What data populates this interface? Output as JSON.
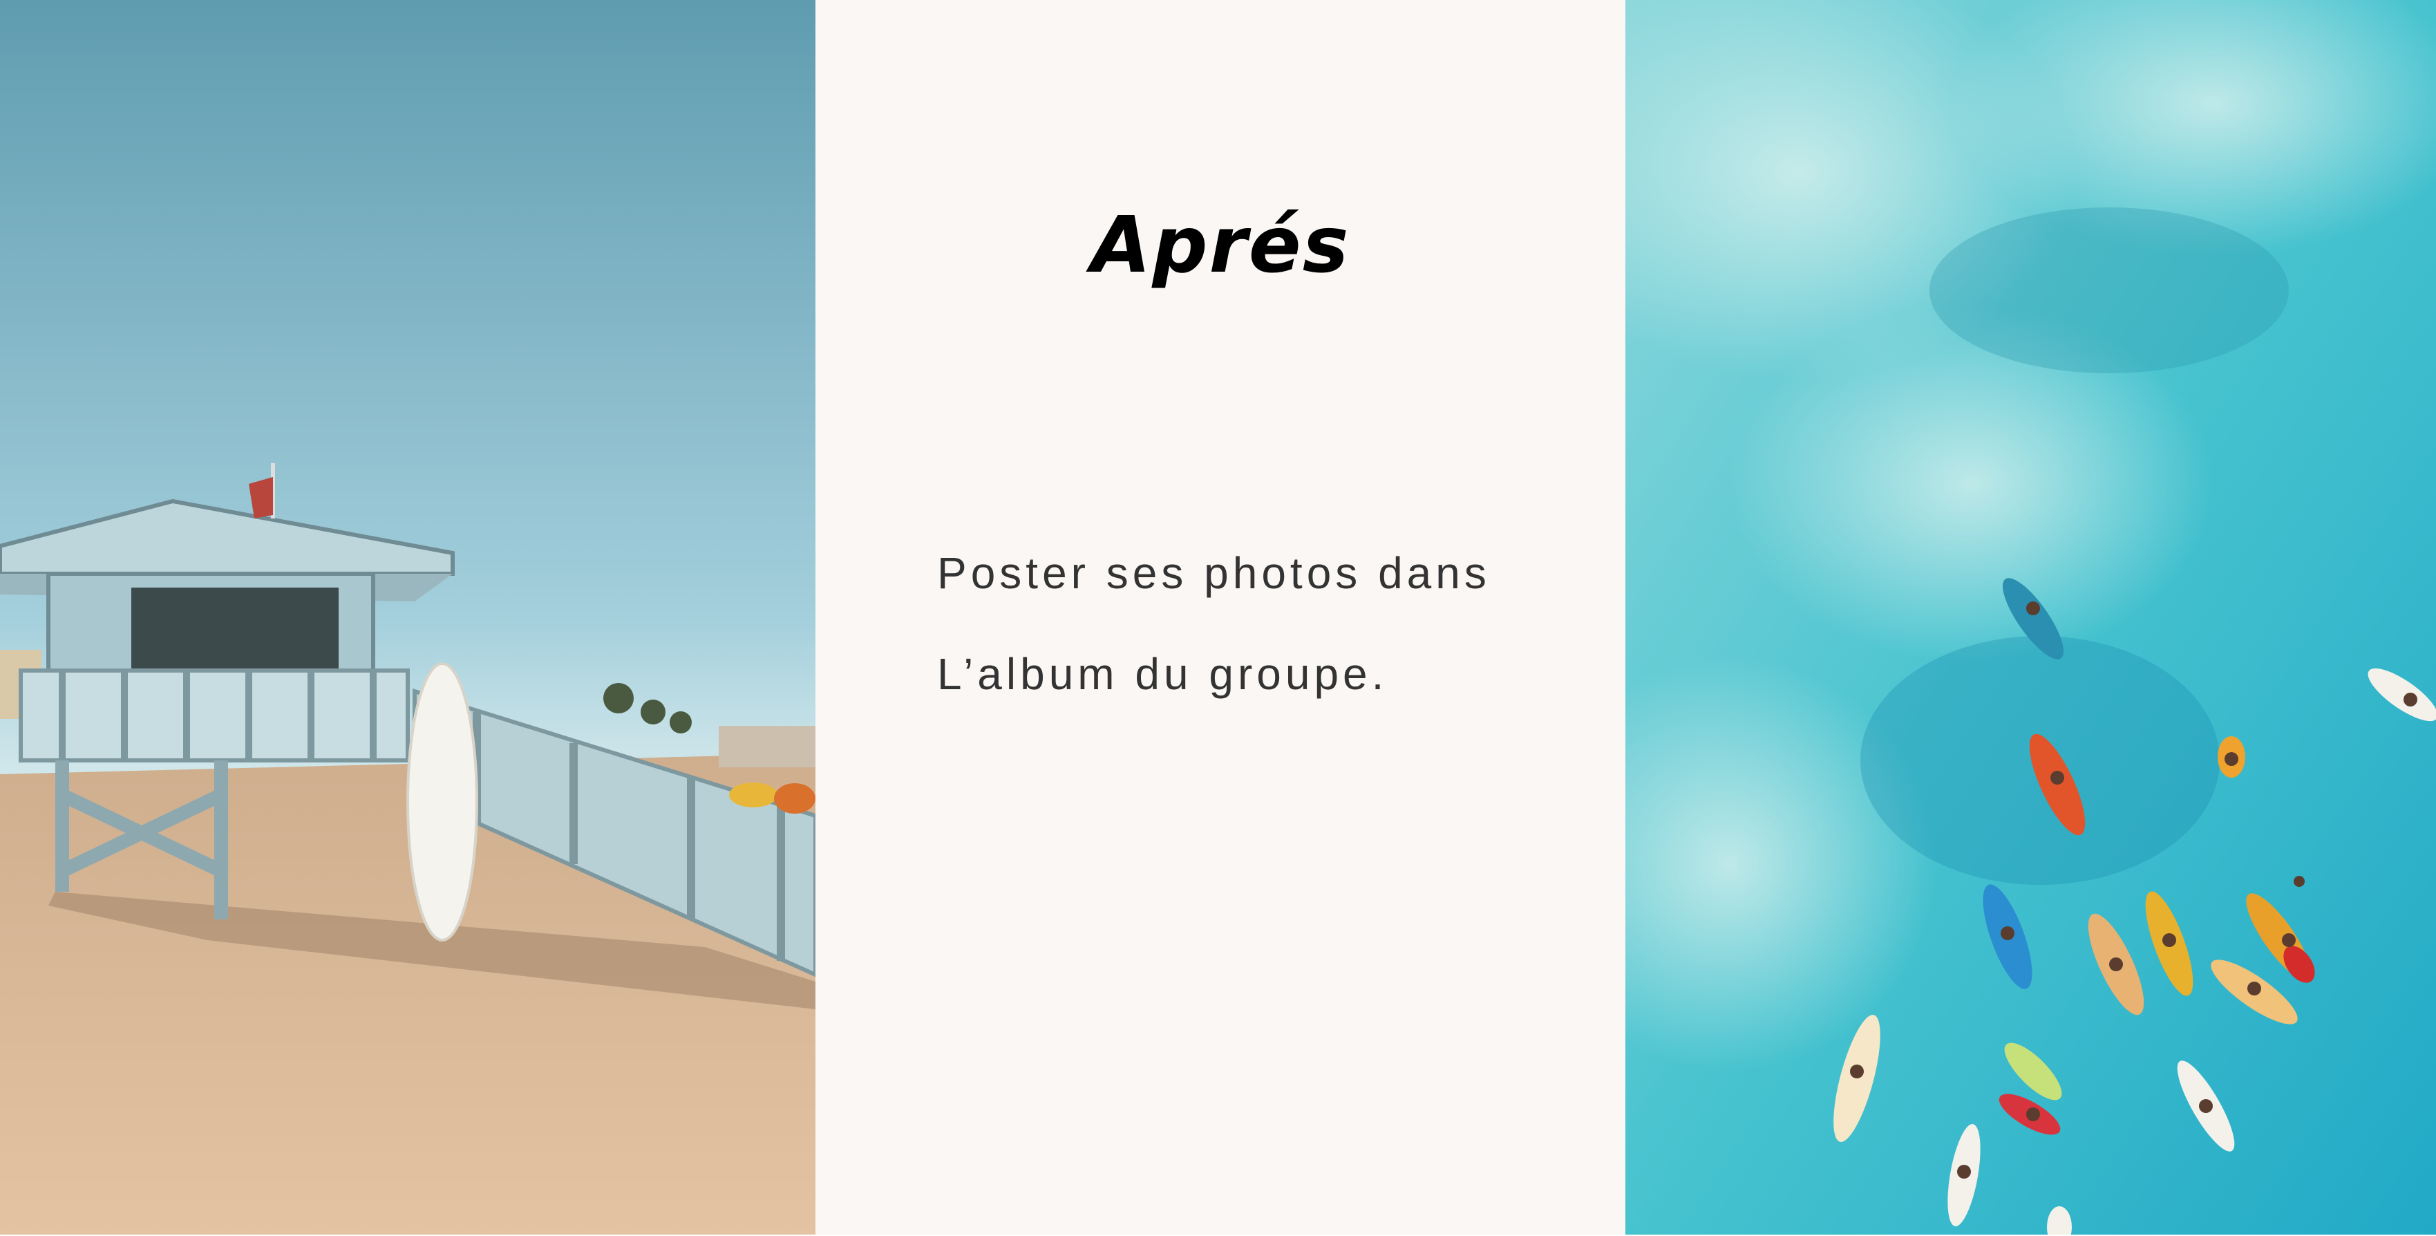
{
  "slide": {
    "title": "Aprés",
    "body_lines": [
      "Poster ses photos dans",
      "L’album du groupe."
    ]
  },
  "colors": {
    "panel_background": "#faf7f4",
    "title_color": "#000000",
    "body_color": "#333333",
    "sky": "#7fb6c8",
    "sand": "#d8b48f",
    "water": "#3fc3cf"
  },
  "images": {
    "left": "beach-lifeguard-tower-photo",
    "right": "aerial-surfers-ocean-photo"
  }
}
